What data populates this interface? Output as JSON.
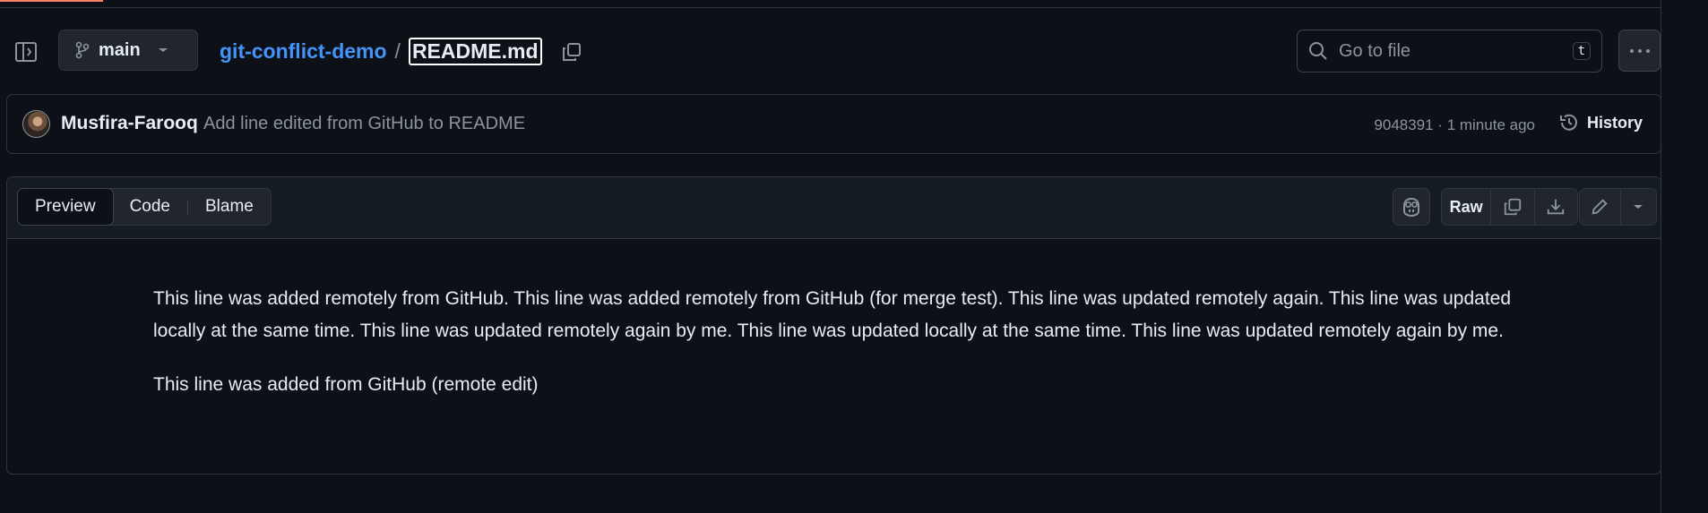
{
  "header": {
    "branch": "main",
    "repo": "git-conflict-demo",
    "separator": "/",
    "file": "README.md",
    "search_placeholder": "Go to file",
    "search_shortcut": "t"
  },
  "commit": {
    "author": "Musfira-Farooq",
    "message": "Add line edited from GitHub to README",
    "meta": "9048391 · 1 minute ago",
    "history_label": "History"
  },
  "file_toolbar": {
    "tabs": [
      "Preview",
      "Code",
      "Blame"
    ],
    "active_tab": "Preview",
    "raw_label": "Raw"
  },
  "content": {
    "paragraphs": [
      "This line was added remotely from GitHub. This line was added remotely from GitHub (for merge test). This line was updated remotely again. This line was updated locally at the same time. This line was updated remotely again by me. This line was updated locally at the same time. This line was updated remotely again by me.",
      "This line was added from GitHub (remote edit)"
    ]
  },
  "colors": {
    "background": "#0d1117",
    "link": "#4493f8",
    "muted": "#8b949e",
    "border": "#30363d"
  },
  "icons": [
    "sidebar-toggle-icon",
    "git-branch-icon",
    "chevron-down-icon",
    "copy-icon",
    "search-icon",
    "kebab-icon",
    "history-icon",
    "copilot-icon",
    "download-icon",
    "pencil-icon"
  ]
}
